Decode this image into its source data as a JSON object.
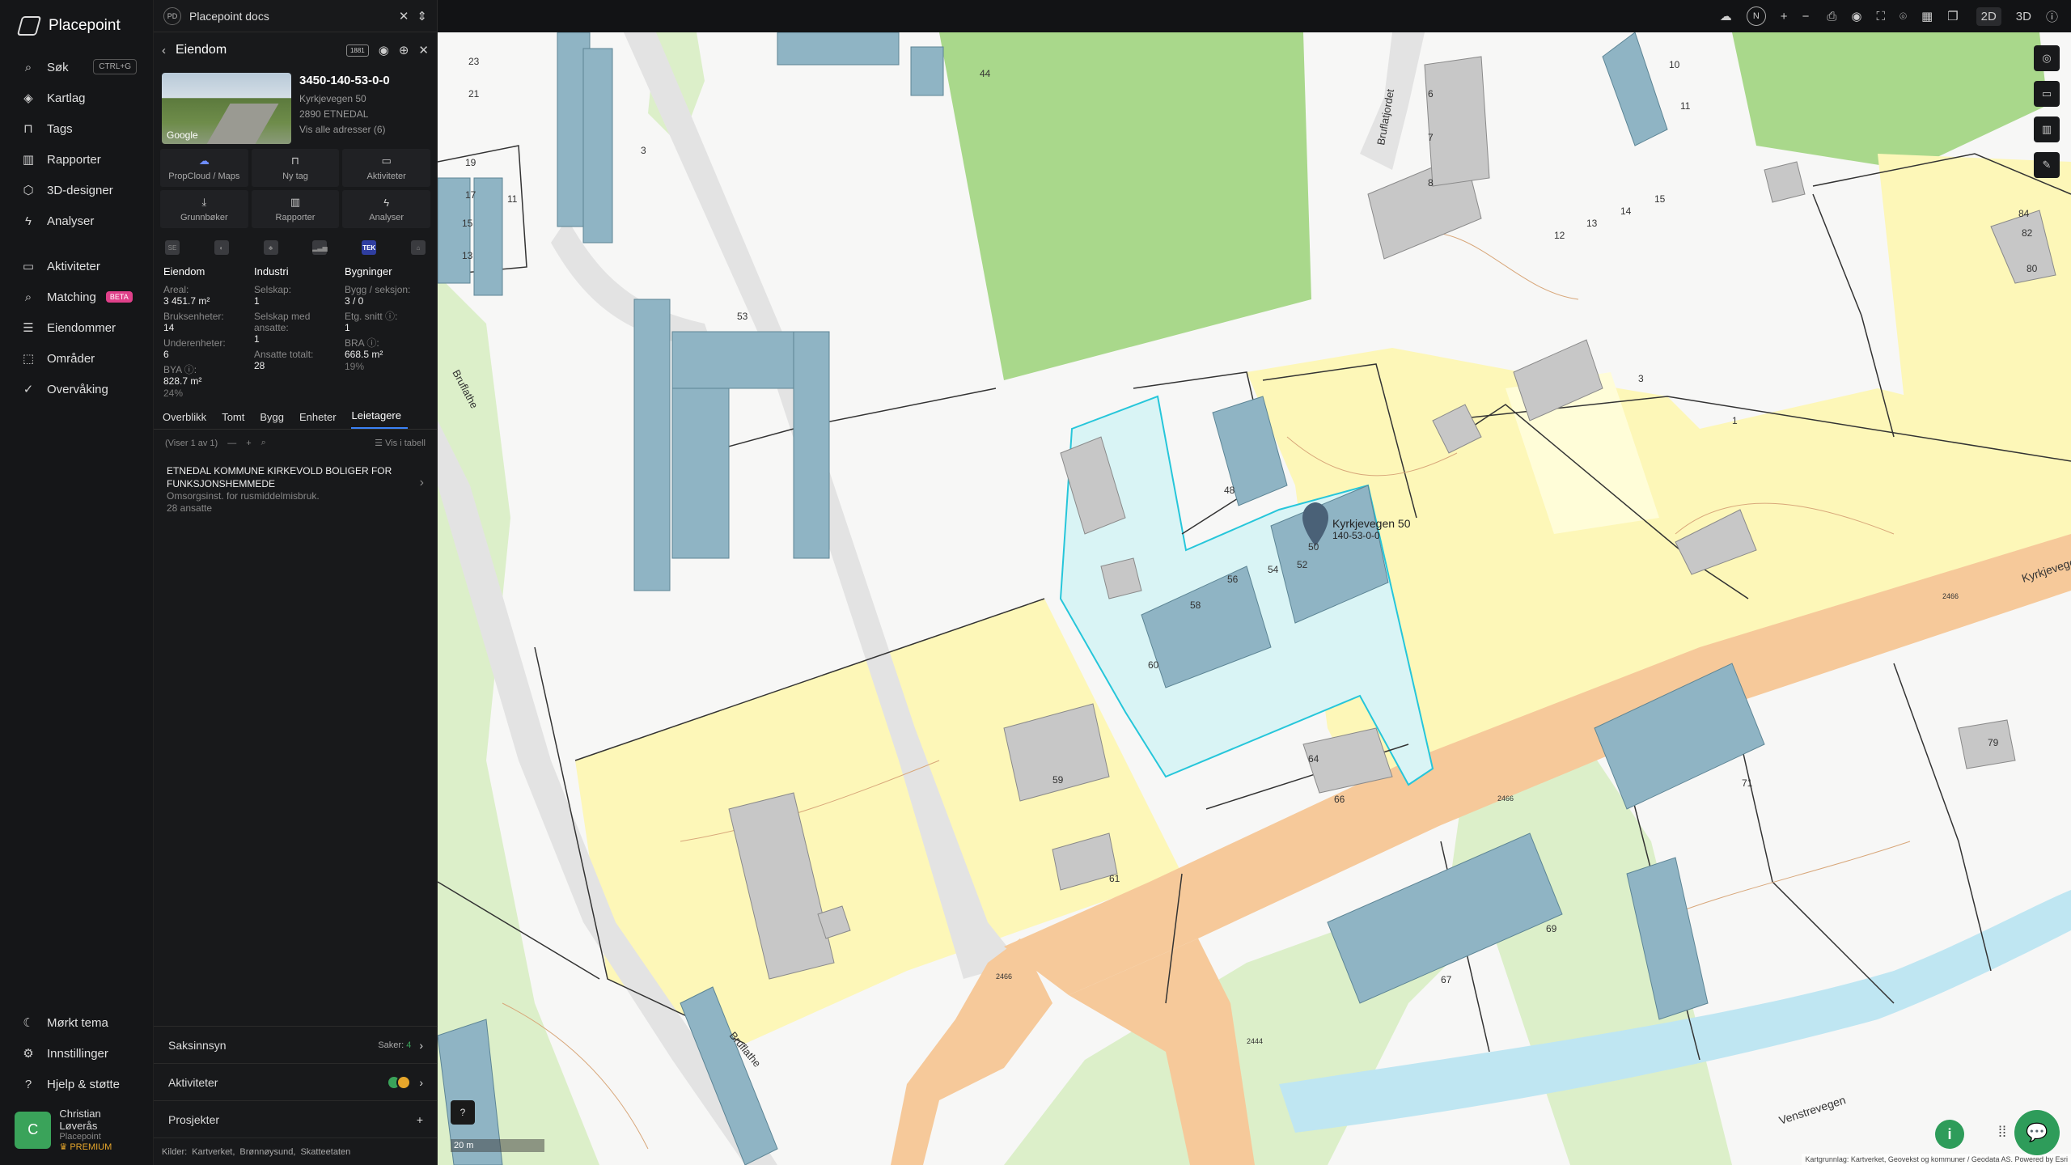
{
  "app": {
    "name": "Placepoint"
  },
  "nav": {
    "items": [
      {
        "id": "sok",
        "label": "Søk",
        "icon": "search-icon",
        "kbd": "CTRL+G"
      },
      {
        "id": "kartlag",
        "label": "Kartlag",
        "icon": "layers-icon"
      },
      {
        "id": "tags",
        "label": "Tags",
        "icon": "bookmark-icon"
      },
      {
        "id": "rapporter",
        "label": "Rapporter",
        "icon": "chart-icon"
      },
      {
        "id": "designer",
        "label": "3D-designer",
        "icon": "cube-icon"
      },
      {
        "id": "analyser",
        "label": "Analyser",
        "icon": "bolt-icon"
      }
    ],
    "items2": [
      {
        "id": "aktiviteter",
        "label": "Aktiviteter",
        "icon": "chat-icon"
      },
      {
        "id": "matching",
        "label": "Matching",
        "icon": "search-icon",
        "badge": "BETA"
      },
      {
        "id": "eiendommer",
        "label": "Eiendommer",
        "icon": "list-icon"
      },
      {
        "id": "omrader",
        "label": "Områder",
        "icon": "area-icon"
      },
      {
        "id": "overvaking",
        "label": "Overvåking",
        "icon": "check-circle-icon"
      }
    ],
    "bottom": [
      {
        "id": "tema",
        "label": "Mørkt tema",
        "icon": "moon-icon"
      },
      {
        "id": "innstillinger",
        "label": "Innstillinger",
        "icon": "gear-icon"
      },
      {
        "id": "hjelp",
        "label": "Hjelp & støtte",
        "icon": "help-icon"
      }
    ],
    "user": {
      "initial": "C",
      "name": "Christian Løverås",
      "org": "Placepoint",
      "plan": "PREMIUM"
    }
  },
  "panel": {
    "doc": {
      "badge": "PD",
      "title": "Placepoint docs"
    },
    "header": {
      "title": "Eiendom",
      "mini_tag": "1881"
    },
    "summary": {
      "id": "3450-140-53-0-0",
      "address": "Kyrkjevegen 50",
      "city": "2890 ETNEDAL",
      "all_addresses": "Vis alle adresser (6)",
      "thumb_label": "Google"
    },
    "actions": [
      {
        "label": "PropCloud / Maps",
        "icon": "cloud-icon"
      },
      {
        "label": "Ny tag",
        "icon": "bookmark-icon"
      },
      {
        "label": "Aktiviteter",
        "icon": "chat-icon"
      },
      {
        "label": "Grunnbøker",
        "icon": "download-icon"
      },
      {
        "label": "Rapporter",
        "icon": "chart-icon"
      },
      {
        "label": "Analyser",
        "icon": "bolt-icon"
      }
    ],
    "icon_row": [
      "SE",
      "◐",
      "♣",
      "▂▃▅",
      "TEK",
      "⌂"
    ],
    "stats": {
      "eiendom": {
        "title": "Eiendom",
        "areal_k": "Areal:",
        "areal_v": "3 451.7 m²",
        "bruks_k": "Bruksenheter:",
        "bruks_v": "14",
        "under_k": "Underenheter:",
        "under_v": "6",
        "bya_k": "BYA ⓘ:",
        "bya_v": "828.7 m²",
        "bya_pct": "24%"
      },
      "industri": {
        "title": "Industri",
        "selskap_k": "Selskap:",
        "selskap_v": "1",
        "ansatte_k": "Selskap med ansatte:",
        "ansatte_v": "1",
        "totalt_k": "Ansatte totalt:",
        "totalt_v": "28"
      },
      "bygninger": {
        "title": "Bygninger",
        "bygg_k": "Bygg / seksjon:",
        "bygg_v": "3 / 0",
        "etg_k": "Etg. snitt ⓘ:",
        "etg_v": "1",
        "bra_k": "BRA ⓘ:",
        "bra_v": "668.5 m²",
        "bra_pct": "19%"
      }
    },
    "tabs": [
      "Overblikk",
      "Tomt",
      "Bygg",
      "Enheter",
      "Leietagere"
    ],
    "active_tab": "Leietagere",
    "list": {
      "showing": "(Viser 1 av 1)",
      "view_table": "Vis i tabell"
    },
    "tenant": {
      "name": "ETNEDAL KOMMUNE KIRKEVOLD BOLIGER FOR FUNKSJONSHEMMEDE",
      "type": "Omsorgsinst. for rusmiddelmisbruk.",
      "employees": "28 ansatte"
    },
    "sections": {
      "saksinnsyn": {
        "label": "Saksinnsyn",
        "meta": "Saker:",
        "count": "4"
      },
      "aktiviteter": {
        "label": "Aktiviteter"
      },
      "prosjekter": {
        "label": "Prosjekter",
        "plus": "+"
      }
    },
    "clients": {
      "label": "Kilder:",
      "items": [
        "Kartverket,",
        "Brønnøysund,",
        "Skatteetaten"
      ]
    }
  },
  "topbar": {
    "mode_2d": "2D",
    "mode_3d": "3D",
    "compass": "N"
  },
  "map": {
    "labels": {
      "marker": "Kyrkjevegen 50",
      "marker_id": "140-53-0-0",
      "road_kyrkje": "Kyrkjevegen",
      "road_venst": "Venstrevegen",
      "road_brufl": "Bruflatjordet",
      "road_brufl2": "Bruflathe",
      "road_brufl3": "Bruflathe",
      "road_no1": "2466",
      "road_no2": "2466",
      "road_no3": "2466",
      "road_no4": "2444",
      "b44": "44",
      "b53": "53",
      "b3": "3",
      "b23": "23",
      "b21": "21",
      "b19": "19",
      "b17": "17",
      "b15": "15",
      "b13": "13",
      "b11": "11",
      "b48": "48",
      "b50": "50",
      "b52": "52",
      "b54": "54",
      "b56": "56",
      "b58": "58",
      "b60": "60",
      "b64": "64",
      "b66": "66",
      "b59": "59",
      "b61": "61",
      "b67": "67",
      "b69": "69",
      "b71": "71",
      "b79": "79",
      "b80": "80",
      "b82": "82",
      "b84": "84",
      "b6": "6",
      "b7": "7",
      "b8": "8",
      "b10": "10",
      "b11b": "11",
      "b12": "12",
      "b13b": "13",
      "b14": "14",
      "b15b": "15",
      "b1": "1",
      "b3b": "3"
    },
    "scale": "20 m",
    "attribution": "Kartgrunnlag: Kartverket, Geovekst og kommuner / Geodata AS. Powered by Esri"
  }
}
